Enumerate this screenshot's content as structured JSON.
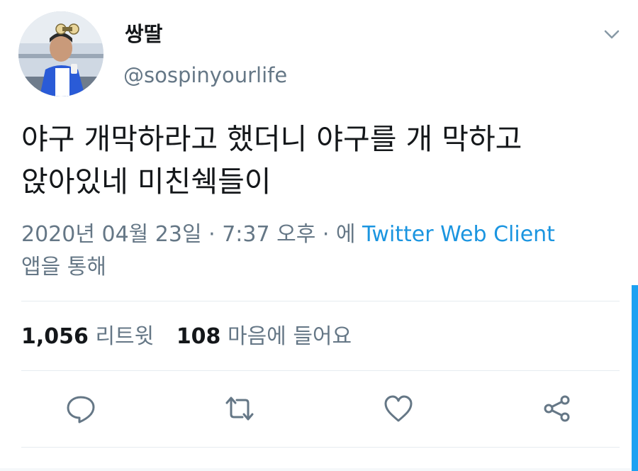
{
  "user": {
    "display_name": "쌍딸",
    "handle": "@sospinyourlife"
  },
  "tweet": {
    "text": "야구 개막하라고 했더니 야구를 개 막하고\n앉아있네 미친쉑들이",
    "date": "2020년 04월 23일",
    "separator1": " · ",
    "time": "7:37 오후",
    "separator2": " · ",
    "via_prefix": "에 ",
    "source": "Twitter Web Client",
    "via_suffix": "앱을 통해"
  },
  "stats": {
    "retweets_count": "1,056",
    "retweets_label": "리트윗",
    "likes_count": "108",
    "likes_label": "마음에 들어요"
  },
  "icons": {
    "reply": "reply-icon",
    "retweet": "retweet-icon",
    "like": "heart-icon",
    "share": "share-icon",
    "menu": "chevron-down-icon"
  },
  "colors": {
    "link": "#1b95e0",
    "secondary_text": "#657786",
    "primary_text": "#14171a",
    "scrollbar": "#1da1f2"
  }
}
